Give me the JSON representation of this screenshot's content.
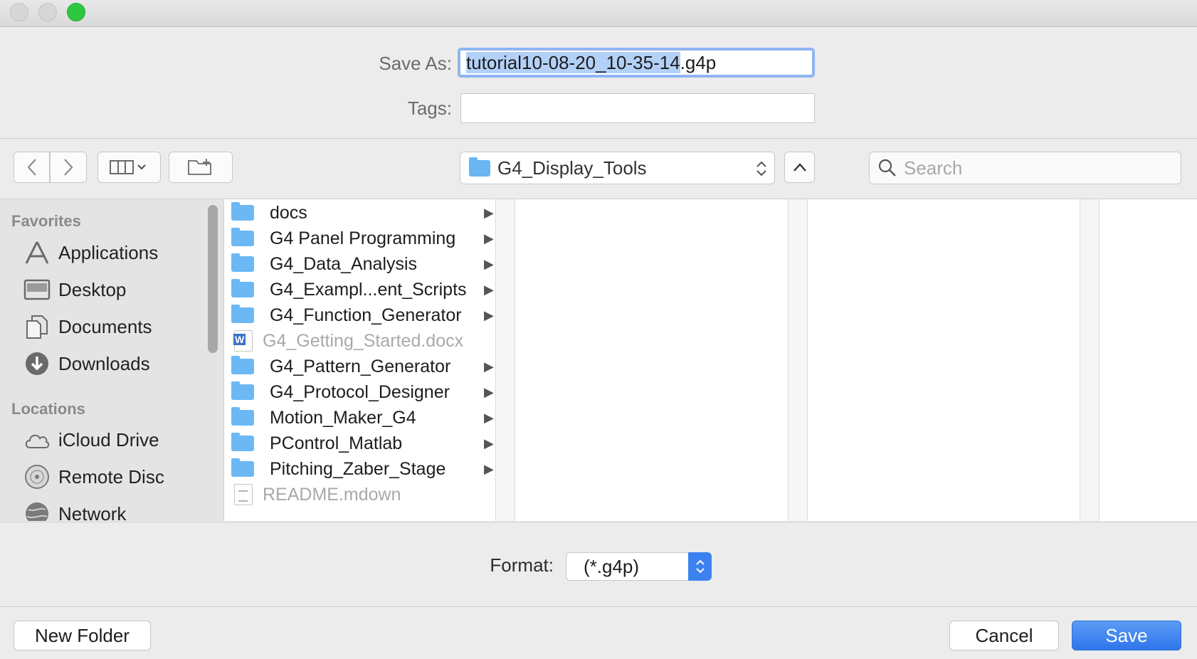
{
  "dialog": {
    "save_as_label": "Save As:",
    "filename_selected": "tutorial10-08-20_10-35-14",
    "filename_ext": ".g4p",
    "tags_label": "Tags:",
    "tags_value": ""
  },
  "toolbar": {
    "back_icon": "chevron-left-icon",
    "forward_icon": "chevron-right-icon",
    "view_icon": "column-view-icon",
    "new_folder_icon": "new-folder-icon",
    "location": "G4_Display_Tools",
    "search_placeholder": "Search"
  },
  "sidebar": {
    "favorites_label": "Favorites",
    "favorites": [
      {
        "label": "Applications",
        "icon": "applications-icon"
      },
      {
        "label": "Desktop",
        "icon": "desktop-icon"
      },
      {
        "label": "Documents",
        "icon": "documents-icon"
      },
      {
        "label": "Downloads",
        "icon": "downloads-icon"
      }
    ],
    "locations_label": "Locations",
    "locations": [
      {
        "label": "iCloud Drive",
        "icon": "icloud-icon"
      },
      {
        "label": "Remote Disc",
        "icon": "disc-icon"
      },
      {
        "label": "Network",
        "icon": "network-icon"
      }
    ]
  },
  "files": [
    {
      "name": "docs",
      "type": "folder"
    },
    {
      "name": "G4 Panel Programming",
      "type": "folder"
    },
    {
      "name": "G4_Data_Analysis",
      "type": "folder"
    },
    {
      "name": "G4_Exampl...ent_Scripts",
      "type": "folder"
    },
    {
      "name": "G4_Function_Generator",
      "type": "folder"
    },
    {
      "name": "G4_Getting_Started.docx",
      "type": "word"
    },
    {
      "name": "G4_Pattern_Generator",
      "type": "folder"
    },
    {
      "name": "G4_Protocol_Designer",
      "type": "folder"
    },
    {
      "name": "Motion_Maker_G4",
      "type": "folder"
    },
    {
      "name": "PControl_Matlab",
      "type": "folder"
    },
    {
      "name": "Pitching_Zaber_Stage",
      "type": "folder"
    },
    {
      "name": "README.mdown",
      "type": "text"
    }
  ],
  "format": {
    "label": "Format:",
    "value": "(*.g4p)"
  },
  "buttons": {
    "new_folder": "New Folder",
    "cancel": "Cancel",
    "save": "Save"
  },
  "colors": {
    "accent": "#3b82f0",
    "folder": "#6cb8f4",
    "selection": "#b3d1f7"
  }
}
